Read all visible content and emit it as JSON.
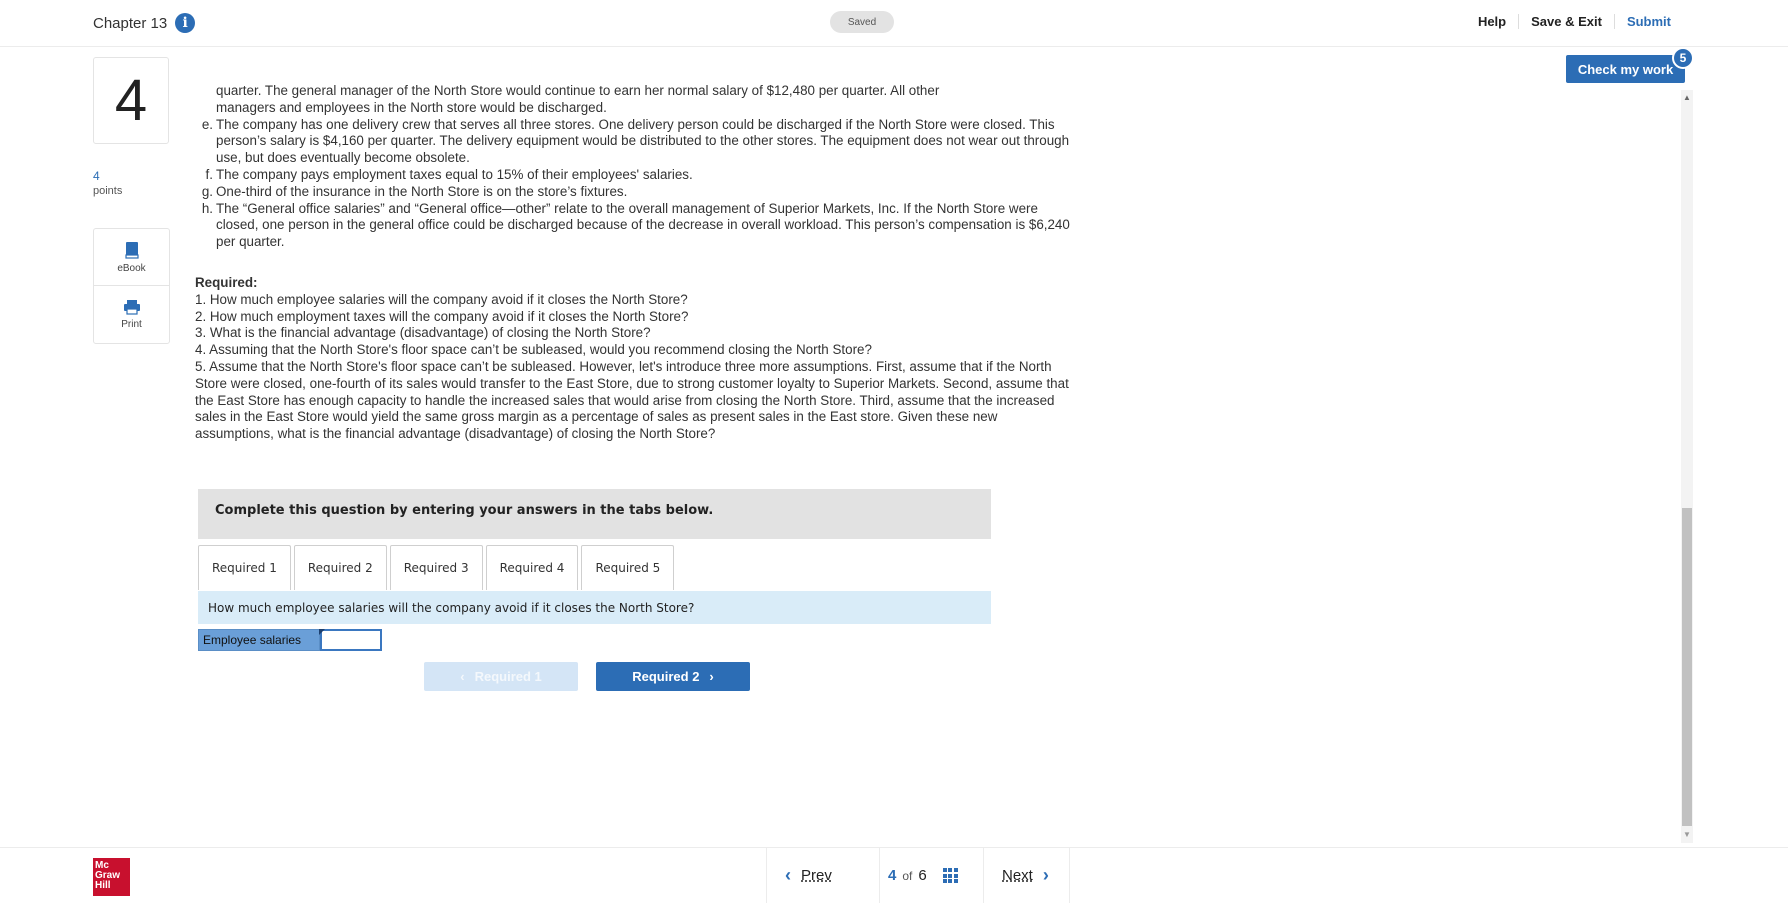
{
  "header": {
    "chapter": "Chapter 13",
    "saved": "Saved",
    "help": "Help",
    "save_exit": "Save & Exit",
    "submit": "Submit"
  },
  "question": {
    "number": "4",
    "points_value": "4",
    "points_label": "points",
    "ebook": "eBook",
    "print": "Print"
  },
  "content": {
    "partial_d_line1": "quarter. The general manager of the North Store would continue to earn her normal salary of $12,480 per quarter. All other",
    "partial_d_line2": "managers and employees in the North store would be discharged.",
    "items": [
      {
        "label": "e.",
        "text": "The company has one delivery crew that serves all three stores. One delivery person could be discharged if the North Store were closed. This person’s salary is $4,160 per quarter. The delivery equipment would be distributed to the other stores. The equipment does not wear out through use, but does eventually become obsolete."
      },
      {
        "label": "f.",
        "text": "The company pays employment taxes equal to 15% of their employees' salaries."
      },
      {
        "label": "g.",
        "text": "One-third of the insurance in the North Store is on the store’s fixtures."
      },
      {
        "label": "h.",
        "text": "The “General office salaries” and “General office—other” relate to the overall management of Superior Markets, Inc. If the North Store were closed, one person in the general office could be discharged because of the decrease in overall workload. This person’s compensation is $6,240 per quarter."
      }
    ],
    "required_heading": "Required:",
    "required": [
      "1. How much employee salaries will the company avoid if it closes the North Store?",
      "2. How much employment taxes will the company avoid if it closes the North Store?",
      "3. What is the financial advantage (disadvantage) of closing the North Store?",
      "4. Assuming that the North Store's floor space can’t be subleased, would you recommend closing the North Store?",
      "5. Assume that the North Store's floor space can’t be subleased. However, let's introduce three more assumptions. First, assume that if the North Store were closed, one-fourth of its sales would transfer to the East Store, due to strong customer loyalty to Superior Markets. Second, assume that the East Store has enough capacity to handle the increased sales that would arise from closing the North Store. Third, assume that the increased sales in the East Store would yield the same gross margin as a percentage of sales as present sales in the East store. Given these new assumptions, what is the financial advantage (disadvantage) of closing the North Store?"
    ]
  },
  "workspace": {
    "instruction": "Complete this question by entering your answers in the tabs below.",
    "tabs": [
      "Required 1",
      "Required 2",
      "Required 3",
      "Required 4",
      "Required 5"
    ],
    "active_question": "How much employee salaries will the company avoid if it closes the North Store?",
    "field_label": "Employee salaries",
    "field_value": "",
    "prev_label": "Required 1",
    "next_label": "Required 2"
  },
  "check": {
    "label": "Check my work",
    "badge": "5"
  },
  "footer": {
    "logo_lines": [
      "Mc",
      "Graw",
      "Hill"
    ],
    "prev": "Prev",
    "current": "4",
    "of": "of",
    "total": "6",
    "next": "Next"
  },
  "colors": {
    "accent": "#2c6db5",
    "logo_red": "#c8102e",
    "question_bar": "#d9ecf8"
  }
}
